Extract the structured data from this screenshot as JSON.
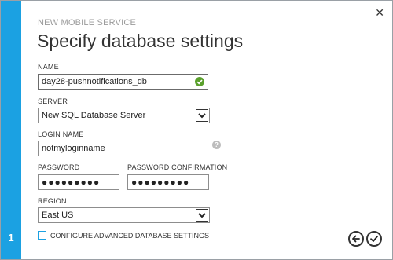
{
  "dialog": {
    "subtitle": "NEW MOBILE SERVICE",
    "title": "Specify database settings",
    "step": "1"
  },
  "fields": {
    "name": {
      "label": "NAME",
      "value": "day28-pushnotifications_db"
    },
    "server": {
      "label": "SERVER",
      "value": "New SQL Database Server"
    },
    "login_name": {
      "label": "LOGIN NAME",
      "value": "notmyloginname"
    },
    "password": {
      "label": "PASSWORD",
      "value": "●●●●●●●●●"
    },
    "password_confirmation": {
      "label": "PASSWORD CONFIRMATION",
      "value": "●●●●●●●●●"
    },
    "region": {
      "label": "REGION",
      "value": "East US"
    }
  },
  "advanced": {
    "label": "CONFIGURE ADVANCED DATABASE SETTINGS"
  },
  "colors": {
    "accent": "#1ba1e2",
    "valid": "#5aa02c"
  },
  "icons": {
    "close": "close-icon",
    "valid": "checkmark-circle-icon",
    "help": "help-icon",
    "back": "arrow-left-icon",
    "finish": "checkmark-icon"
  }
}
